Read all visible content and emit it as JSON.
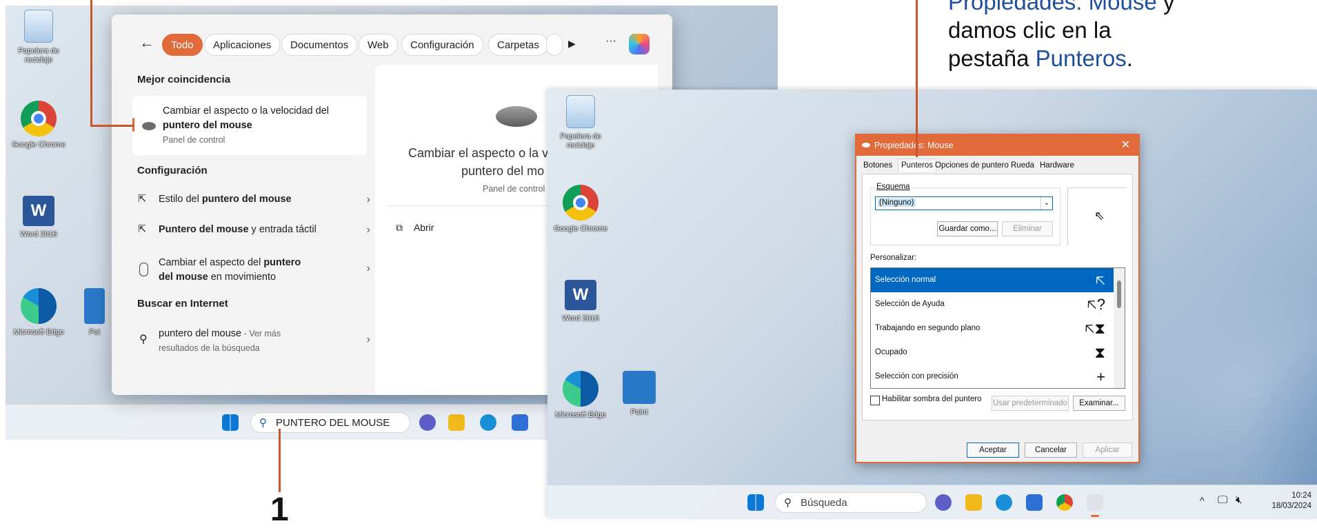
{
  "callout": {
    "line1a": "Propiedades: Mouse",
    "line1b": " y",
    "line2": "damos clic en la",
    "line3a": "pestaña ",
    "line3b": "Punteros",
    "line3c": ".",
    "step_number": "1"
  },
  "desktop_left": {
    "icons": [
      {
        "label": "Papelera de reciclaje"
      },
      {
        "label": "Google Chrome"
      },
      {
        "label": "Word 2016"
      },
      {
        "label": "Microsoft Edge"
      },
      {
        "label": "Pai"
      }
    ]
  },
  "search": {
    "filters": [
      "Todo",
      "Aplicaciones",
      "Documentos",
      "Web",
      "Configuración",
      "Carpetas"
    ],
    "more": "···",
    "best_match_heading": "Mejor coincidencia",
    "best_match": {
      "line1": "Cambiar el aspecto o la velocidad del",
      "line2": "puntero del mouse",
      "source": "Panel de control"
    },
    "config_heading": "Configuración",
    "config_items": [
      {
        "pre": "Estilo del ",
        "bold": "puntero del mouse",
        "post": ""
      },
      {
        "pre": "",
        "bold": "Puntero del mouse",
        "post": " y entrada táctil"
      },
      {
        "pre": "Cambiar el aspecto del ",
        "bold": "puntero",
        "line2bold": "del mouse",
        "line2post": " en movimiento"
      }
    ],
    "internet_heading": "Buscar en Internet",
    "internet_item": {
      "bold": "puntero del mouse",
      "post": " - Ver más",
      "line2": "resultados de la búsqueda"
    },
    "preview": {
      "title_line1": "Cambiar el aspecto o la v",
      "title_line2": "puntero del mo",
      "source": "Panel de control",
      "open": "Abrir"
    },
    "query": "PUNTERO DEL MOUSE"
  },
  "desktop_right": {
    "icons": [
      {
        "label": "Papelera de reciclaje"
      },
      {
        "label": "Google Chrome"
      },
      {
        "label": "Word 2016"
      },
      {
        "label": "Microsoft Edge"
      },
      {
        "label": "Paint"
      }
    ],
    "taskbar_search": "Búsqueda",
    "time": "10:24",
    "date": "18/03/2024"
  },
  "dialog": {
    "title": "Propiedades: Mouse",
    "tabs": [
      "Botones",
      "Punteros",
      "Opciones de puntero",
      "Rueda",
      "Hardware"
    ],
    "scheme_label": "Esquema",
    "scheme_value": "(Ninguno)",
    "save_as": "Guardar como...",
    "delete": "Eliminar",
    "customize_label": "Personalizar:",
    "cursors": [
      {
        "name": "Selección normal",
        "glyph": "🡤"
      },
      {
        "name": "Selección de Ayuda",
        "glyph": "🡤?"
      },
      {
        "name": "Trabajando en segundo plano",
        "glyph": "🡤⧗"
      },
      {
        "name": "Ocupado",
        "glyph": "⧗"
      },
      {
        "name": "Selección con precisión",
        "glyph": "+"
      }
    ],
    "shadow_label": "Habilitar sombra del puntero",
    "use_default": "Usar predeterminado",
    "browse": "Examinar...",
    "ok": "Aceptar",
    "cancel": "Cancelar",
    "apply": "Aplicar"
  },
  "colors": {
    "accent": "#e06a3a",
    "callout_blue": "#1f4e9c",
    "selection": "#0067c0"
  }
}
